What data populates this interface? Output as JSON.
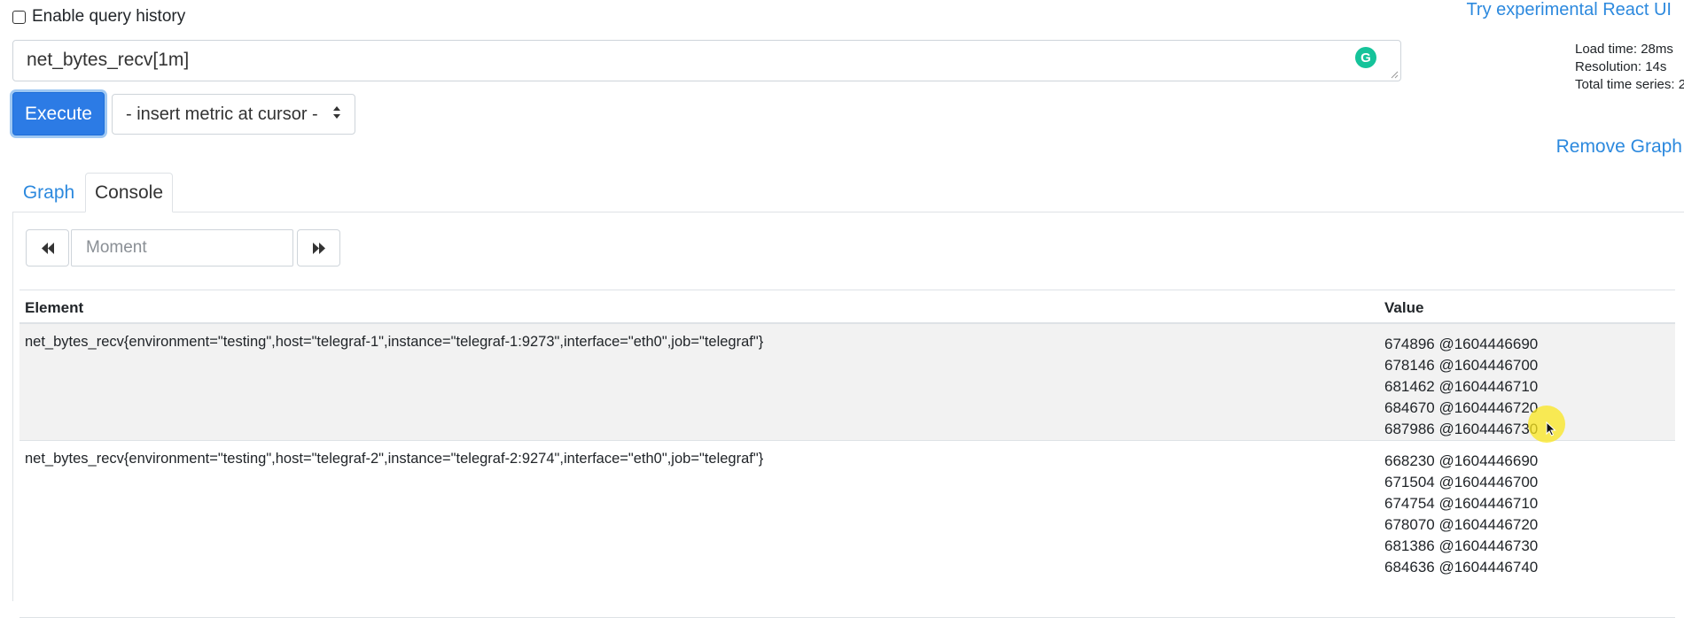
{
  "header": {
    "history_label": "Enable query history",
    "react_link": "Try experimental React UI"
  },
  "stats": {
    "load_time": "Load time: 28ms",
    "resolution": "Resolution: 14s",
    "total_series": "Total time series: 2"
  },
  "query": {
    "expression": "net_bytes_recv[1m]",
    "grammarly_icon": "G"
  },
  "controls": {
    "execute_label": "Execute",
    "metric_select_label": "- insert metric at cursor -",
    "remove_graph_label": "Remove Graph"
  },
  "tabs": [
    {
      "label": "Graph",
      "active": false
    },
    {
      "label": "Console",
      "active": true
    }
  ],
  "console": {
    "moment_placeholder": "Moment",
    "columns": [
      "Element",
      "Value"
    ],
    "rows": [
      {
        "element": "net_bytes_recv{environment=\"testing\",host=\"telegraf-1\",instance=\"telegraf-1:9273\",interface=\"eth0\",job=\"telegraf\"}",
        "values": [
          "674896 @1604446690",
          "678146 @1604446700",
          "681462 @1604446710",
          "684670 @1604446720",
          "687986 @1604446730"
        ]
      },
      {
        "element": "net_bytes_recv{environment=\"testing\",host=\"telegraf-2\",instance=\"telegraf-2:9274\",interface=\"eth0\",job=\"telegraf\"}",
        "values": [
          "668230 @1604446690",
          "671504 @1604446700",
          "674754 @1604446710",
          "678070 @1604446720",
          "681386 @1604446730",
          "684636 @1604446740"
        ]
      }
    ]
  },
  "icons": {
    "prev": "fast-backward-icon",
    "next": "fast-forward-icon",
    "select_arrows": "sort-arrows-icon",
    "cursor": "mouse-pointer-icon"
  },
  "colors": {
    "link": "#2c89de",
    "primary": "#2c7be5",
    "grammarly": "#15c39a",
    "row_stripe": "#f2f2f2"
  }
}
